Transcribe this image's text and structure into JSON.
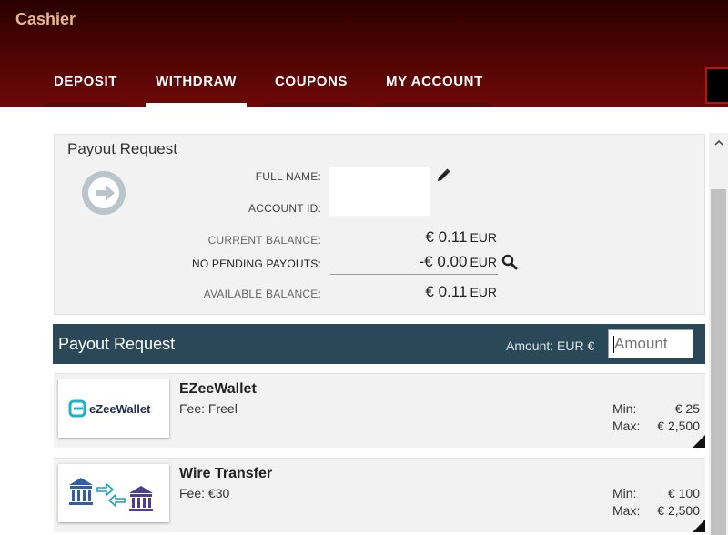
{
  "app": {
    "title": "Cashier"
  },
  "tabs": [
    {
      "label": "DEPOSIT"
    },
    {
      "label": "WITHDRAW"
    },
    {
      "label": "COUPONS"
    },
    {
      "label": "MY ACCOUNT"
    }
  ],
  "active_tab": "WITHDRAW",
  "payout_card": {
    "title": "Payout Request",
    "full_name_label": "FULL NAME:",
    "full_name_value": "",
    "account_id_label": "ACCOUNT ID:",
    "account_id_value": "",
    "current_balance_label": "CURRENT BALANCE:",
    "current_balance_amount": "€ 0.11",
    "current_balance_currency": "EUR",
    "pending_label": "NO PENDING PAYOUTS:",
    "pending_amount": "-€ 0.00",
    "pending_currency": "EUR",
    "available_balance_label": "AVAILABLE BALANCE:",
    "available_balance_amount": "€ 0.11",
    "available_balance_currency": "EUR"
  },
  "payout_bar": {
    "title": "Payout Request",
    "amount_label": "Amount:  EUR €",
    "amount_placeholder": "Amount",
    "amount_value": ""
  },
  "methods": [
    {
      "name": "EZeeWallet",
      "fee": "Fee: Freel",
      "logo_text": "eZeeWallet",
      "min_label": "Min:",
      "min_value": "€ 25",
      "max_label": "Max:",
      "max_value": "€ 2,500"
    },
    {
      "name": "Wire Transfer",
      "fee": "Fee: €30",
      "min_label": "Min:",
      "min_value": "€ 100",
      "max_label": "Max:",
      "max_value": "€ 2,500"
    }
  ],
  "colors": {
    "header_dark": "#2a0000",
    "header_red": "#6e0808",
    "title_gold": "#e4b98a",
    "bar_slate": "#2b4858",
    "card_grey": "#f2f2f2",
    "ezee_teal": "#19b4c8",
    "bank_blue": "#2f5fa6",
    "bank_purple": "#4b3d8f"
  },
  "icons": [
    "arrow-right-icon",
    "pencil-icon",
    "search-icon",
    "ezeewallet-logo",
    "bank-transfer-logo",
    "chevron-up-icon"
  ]
}
